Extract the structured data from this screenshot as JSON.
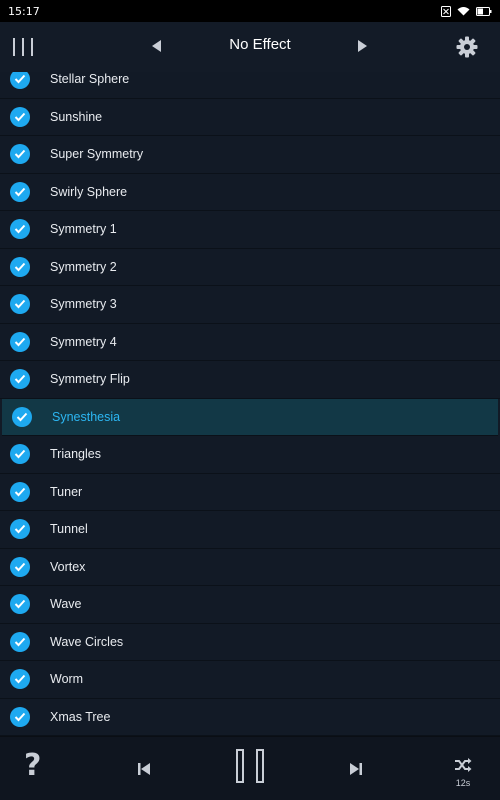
{
  "status_bar": {
    "time": "15:17",
    "battery_level": 0.5
  },
  "app_bar": {
    "title": "No Effect",
    "icons": [
      "menu-icon",
      "previous-effect-icon",
      "next-effect-icon",
      "gear-icon"
    ]
  },
  "effects": [
    {
      "label": "Stellar Sphere",
      "checked": true
    },
    {
      "label": "Sunshine",
      "checked": true
    },
    {
      "label": "Super Symmetry",
      "checked": true
    },
    {
      "label": "Swirly Sphere",
      "checked": true
    },
    {
      "label": "Symmetry 1",
      "checked": true
    },
    {
      "label": "Symmetry 2",
      "checked": true
    },
    {
      "label": "Symmetry 3",
      "checked": true
    },
    {
      "label": "Symmetry 4",
      "checked": true
    },
    {
      "label": "Symmetry Flip",
      "checked": true
    },
    {
      "label": "Synesthesia",
      "checked": true,
      "selected": true
    },
    {
      "label": "Triangles",
      "checked": true
    },
    {
      "label": "Tuner",
      "checked": true
    },
    {
      "label": "Tunnel",
      "checked": true
    },
    {
      "label": "Vortex",
      "checked": true
    },
    {
      "label": "Wave",
      "checked": true
    },
    {
      "label": "Wave Circles",
      "checked": true
    },
    {
      "label": "Worm",
      "checked": true
    },
    {
      "label": "Xmas Tree",
      "checked": true
    }
  ],
  "bottom_bar": {
    "help_symbol": "?",
    "shuffle_interval": "12s",
    "icons": [
      "help-icon",
      "previous-track-icon",
      "pause-icon",
      "next-track-icon",
      "shuffle-icon"
    ]
  },
  "colors": {
    "accent": "#1ea9f0",
    "selected_text": "#2cb6f2",
    "selected_row": "#123846",
    "background": "#121a26"
  }
}
